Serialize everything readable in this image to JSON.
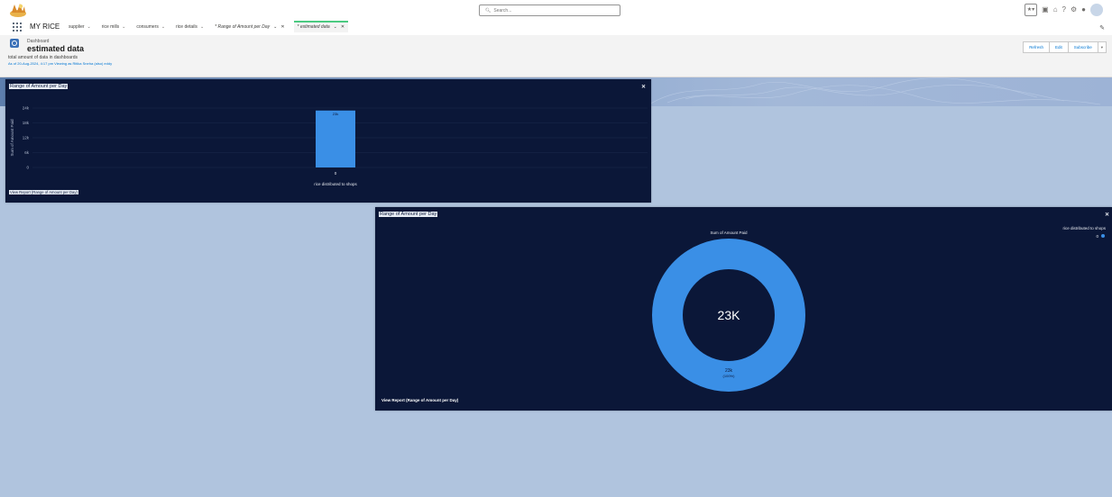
{
  "header": {
    "search_placeholder": "Search...",
    "utility_icons": [
      "favorites-icon",
      "add-icon",
      "setup-assistant-icon",
      "help-icon",
      "gear-icon",
      "notifications-icon",
      "avatar"
    ]
  },
  "nav": {
    "app_name": "MY RICE",
    "items": [
      {
        "label": "supplier"
      },
      {
        "label": "rice mills"
      },
      {
        "label": "consumers"
      },
      {
        "label": "rice details"
      }
    ],
    "tabs": [
      {
        "label": "* Range of Amount per Day",
        "active": false
      },
      {
        "label": "* estimated data",
        "active": true
      }
    ]
  },
  "page": {
    "entity_type": "Dashboard",
    "title": "estimated data",
    "description": "total amount of data in dashboards",
    "as_of": "As of 20-Aug-2024, 4:17 pm Viewing as Ritika Sneha (also) eddy",
    "buttons": {
      "refresh": "Refresh",
      "edit": "Edit",
      "subscribe": "Subscribe"
    }
  },
  "widget1": {
    "title": "Range of Amount per Day",
    "footer": "View Report (Range of Amount per Day)",
    "close_icon": "close-icon"
  },
  "widget2": {
    "title": "Range of Amount per Day",
    "footer": "View Report (Range of Amount per Day)",
    "chart_title": "Sum of Amount Paid",
    "legend_title": "rice distributed to shops",
    "legend_value": "0",
    "center_label": "23K",
    "slice_label": "23k",
    "slice_pct": "(100%)"
  },
  "colors": {
    "widget_bg": "#0b1738",
    "bar": "#3a8fe6",
    "page_bg": "#b0c4de"
  },
  "chart_data": [
    {
      "type": "bar",
      "title": "",
      "xlabel": "rice distributed to shops",
      "ylabel": "Sum of Amount Paid",
      "categories": [
        "0"
      ],
      "values": [
        23000
      ],
      "data_labels": [
        "23k"
      ],
      "yticks": [
        "0",
        "6k",
        "12k",
        "18k",
        "24k"
      ],
      "ylim": [
        0,
        24000
      ],
      "grid": true
    },
    {
      "type": "pie",
      "donut": true,
      "title": "Sum of Amount Paid",
      "legend_title": "rice distributed to shops",
      "legend_position": "top-right",
      "labels": [
        "0"
      ],
      "values": [
        23000
      ],
      "percentages": [
        100
      ],
      "center_total": "23K"
    }
  ]
}
